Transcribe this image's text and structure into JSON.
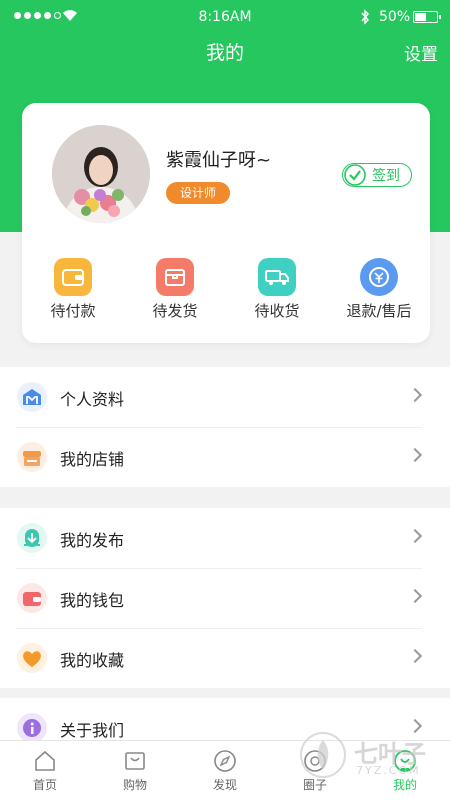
{
  "status_bar": {
    "time": "8:16AM",
    "battery": "50%"
  },
  "header": {
    "title": "我的",
    "settings_label": "设置",
    "accent_color": "#27c760"
  },
  "profile": {
    "name": "紫霞仙子呀~",
    "role": "设计师",
    "checkin_label": "签到"
  },
  "orders": [
    {
      "label": "待付款",
      "icon": "wallet-icon"
    },
    {
      "label": "待发货",
      "icon": "box-icon"
    },
    {
      "label": "待收货",
      "icon": "truck-icon"
    },
    {
      "label": "退款/售后",
      "icon": "refund-icon"
    }
  ],
  "menu": {
    "group1": [
      {
        "label": "个人资料",
        "icon": "profile-icon"
      },
      {
        "label": "我的店铺",
        "icon": "store-icon"
      }
    ],
    "group2": [
      {
        "label": "我的发布",
        "icon": "publish-icon"
      },
      {
        "label": "我的钱包",
        "icon": "wallet-icon"
      },
      {
        "label": "我的收藏",
        "icon": "heart-icon"
      }
    ],
    "group3": [
      {
        "label": "关于我们",
        "icon": "info-icon"
      }
    ]
  },
  "tabbar": [
    {
      "label": "首页",
      "icon": "home-icon"
    },
    {
      "label": "购物",
      "icon": "shopping-icon"
    },
    {
      "label": "发现",
      "icon": "compass-icon"
    },
    {
      "label": "圈子",
      "icon": "circle-icon"
    },
    {
      "label": "我的",
      "icon": "me-icon",
      "active": true
    }
  ],
  "watermark": {
    "text": "七叶子",
    "sub": "7YZ.COM"
  }
}
